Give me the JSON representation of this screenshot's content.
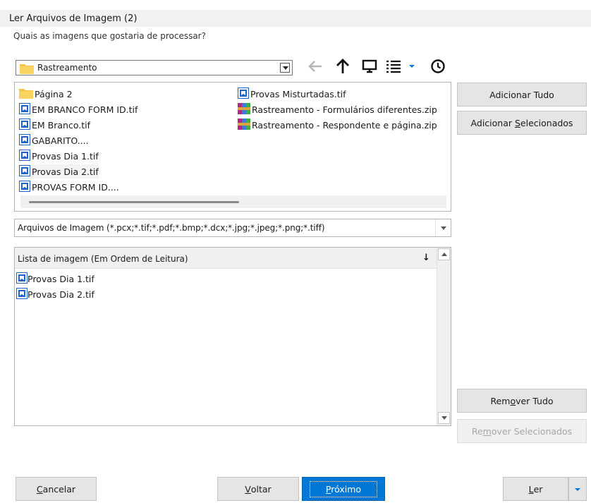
{
  "window": {
    "title": "Ler Arquivos de Imagem (2)",
    "question": "Quais as imagens que gostaria de processar?"
  },
  "folder": {
    "current": "Rastreamento",
    "icons": [
      "back-arrow-icon",
      "up-arrow-icon",
      "desktop-icon",
      "view-list-icon",
      "chevron-down-icon",
      "recent-icon"
    ]
  },
  "browser": {
    "col1": [
      {
        "name": "Página 2",
        "type": "folder"
      },
      {
        "name": "EM BRANCO FORM ID.tif",
        "type": "image"
      },
      {
        "name": "EM Branco.tif",
        "type": "image"
      },
      {
        "name": "GABARITO....",
        "type": "image"
      },
      {
        "name": "Provas Dia 1.tif",
        "type": "image"
      },
      {
        "name": "Provas Dia 2.tif",
        "type": "image"
      },
      {
        "name": "PROVAS FORM ID....",
        "type": "image"
      }
    ],
    "col2": [
      {
        "name": "Provas Misturtadas.tif",
        "type": "image"
      },
      {
        "name": "Rastreamento - Formulários diferentes.zip",
        "type": "zip"
      },
      {
        "name": "Rastreamento - Respondente e página.zip",
        "type": "zip"
      }
    ]
  },
  "buttons": {
    "add_all": "Adicionar Tudo",
    "add_selected_pre": "Adicionar ",
    "add_selected_u": "S",
    "add_selected_post": "elecionados",
    "remove_all_pre": "Rem",
    "remove_all_u": "o",
    "remove_all_post": "ver Tudo",
    "remove_selected_pre": "Re",
    "remove_selected_u": "m",
    "remove_selected_post": "over Selecionados",
    "cancel_u": "C",
    "cancel_post": "ancelar",
    "back_u": "V",
    "back_post": "oltar",
    "next_u": "P",
    "next_post": "róximo",
    "read_u": "L",
    "read_post": "er"
  },
  "filter": {
    "value": "Arquivos de Imagem (*.pcx;*.tif;*.pdf;*.bmp;*.dcx;*.jpg;*.jpeg;*.png;*.tiff)"
  },
  "image_list": {
    "header": "Lista de imagem (Em Ordem de Leitura)",
    "items": [
      "Provas Dia 1.tif",
      "Provas Dia 2.tif"
    ]
  },
  "colors": {
    "accent": "#0078d7",
    "folder": "#f5c242",
    "image_icon": "#1e64c8"
  }
}
